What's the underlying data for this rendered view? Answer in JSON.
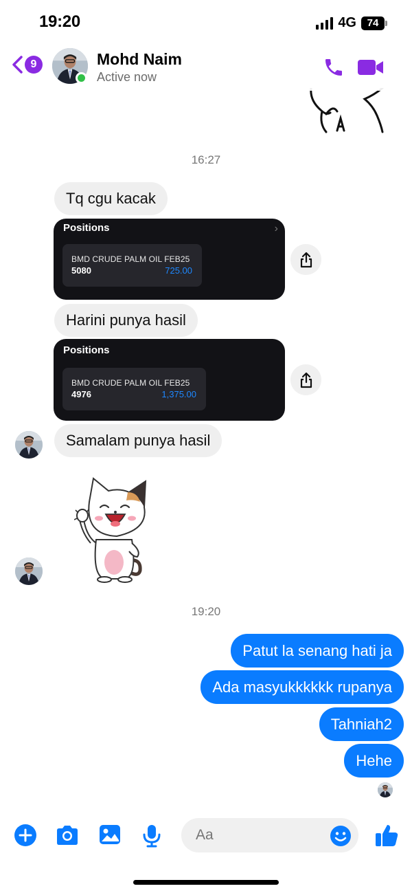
{
  "status_bar": {
    "time": "19:20",
    "network": "4G",
    "battery": "74"
  },
  "header": {
    "unread_count": "9",
    "contact_name": "Mohd Naim",
    "contact_status": "Active now"
  },
  "colors": {
    "accent": "#8a2be2",
    "outgoing_bubble": "#0a7cff",
    "incoming_bubble": "#efefef",
    "online": "#31c048"
  },
  "icons": {
    "back": "chevron-left-icon",
    "call": "phone-icon",
    "video": "video-camera-icon",
    "share": "share-icon",
    "add": "plus-circle-icon",
    "camera": "camera-icon",
    "gallery": "image-icon",
    "mic": "microphone-icon",
    "emoji": "smile-icon",
    "like": "thumbs-up-icon"
  },
  "conversation": {
    "timestamp_1": "16:27",
    "incoming_1": "Tq cgu kacak",
    "screenshot_1": {
      "title": "Positions",
      "symbol": "BMD CRUDE PALM OIL FEB25",
      "quantity": "5080",
      "pnl": "725.00"
    },
    "incoming_2": "Harini punya hasil",
    "screenshot_2": {
      "title": "Positions",
      "symbol": "BMD CRUDE PALM OIL FEB25",
      "quantity": "4976",
      "pnl": "1,375.00"
    },
    "incoming_3": "Samalam punya hasil",
    "timestamp_2": "19:20",
    "outgoing": [
      "Patut la senang hati ja",
      "Ada masyukkkkkk rupanya",
      "Tahniah2",
      "Hehe"
    ]
  },
  "composer": {
    "placeholder": "Aa"
  }
}
